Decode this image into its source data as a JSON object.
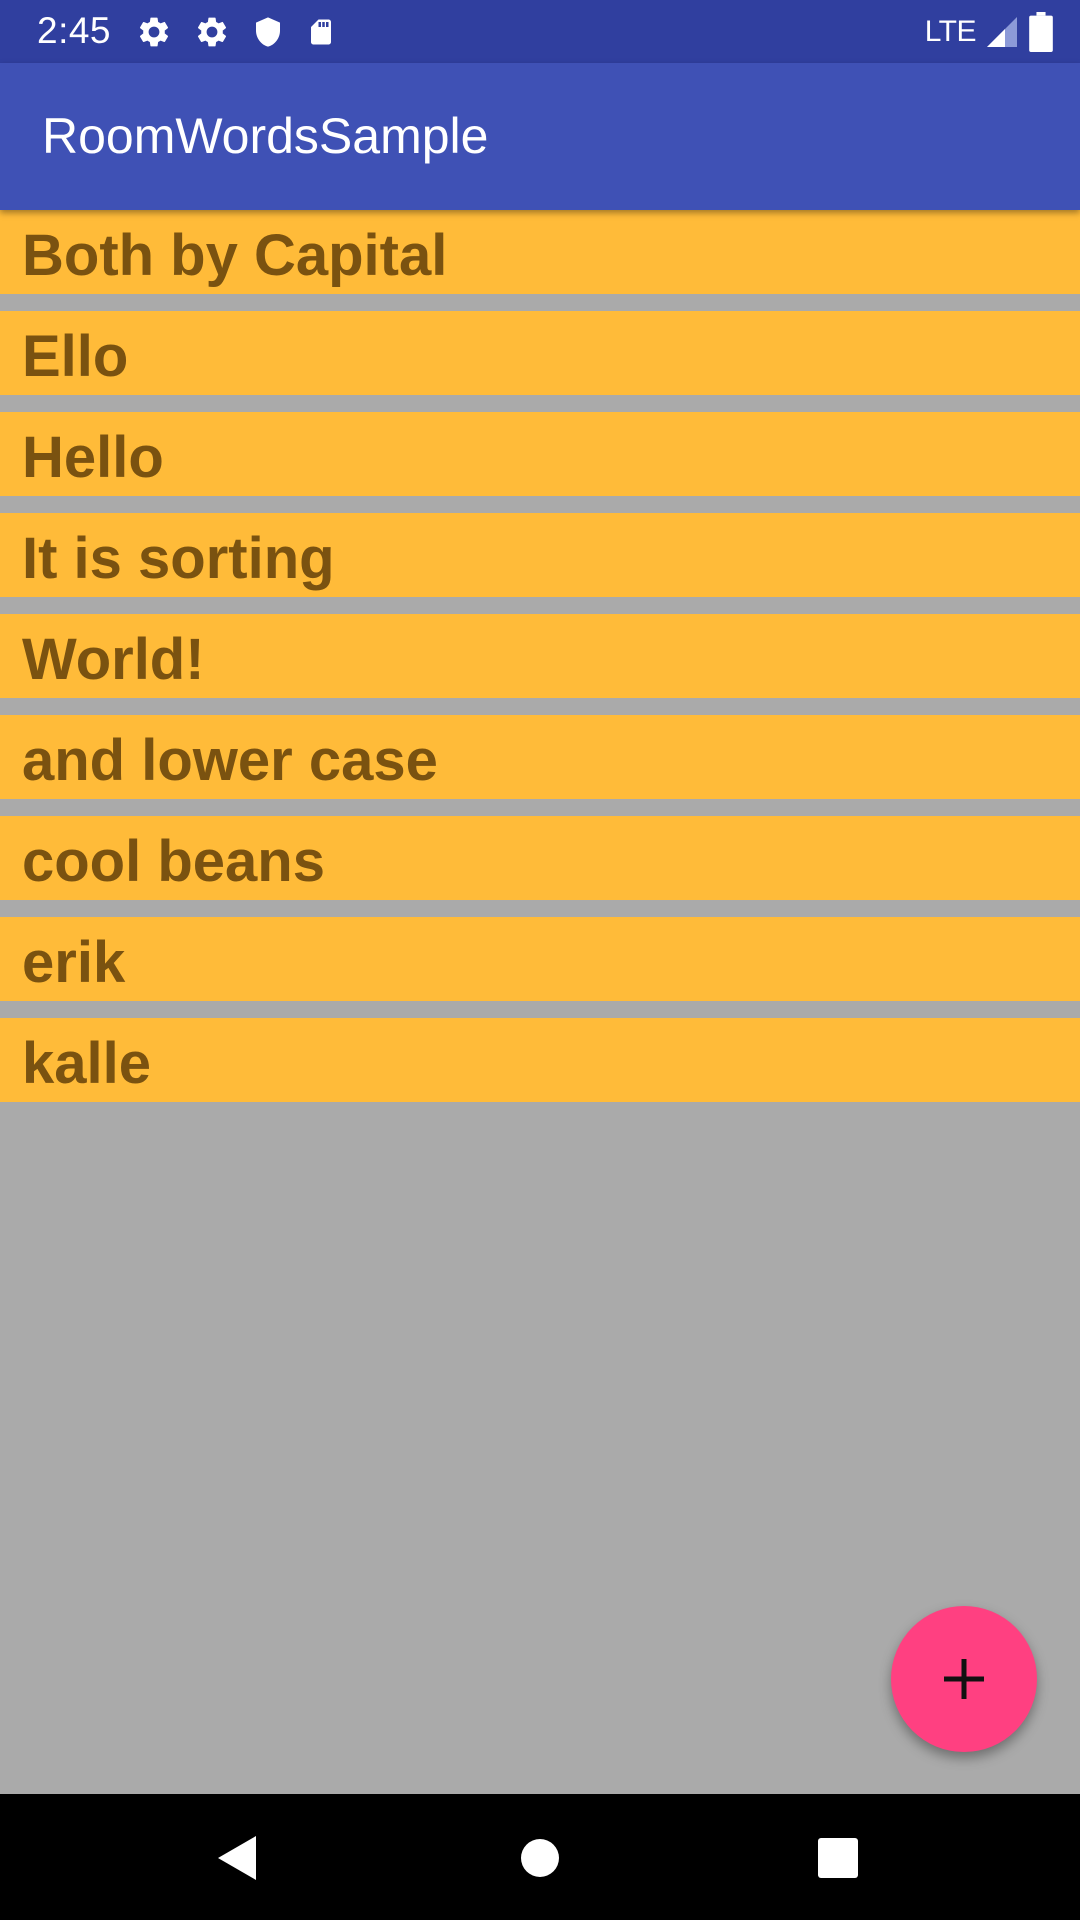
{
  "status_bar": {
    "time": "2:45",
    "network": "LTE",
    "left_icons": [
      "settings-icon",
      "settings-icon",
      "shield-icon",
      "sd-card-icon"
    ],
    "right_icons": [
      "signal-icon",
      "battery-icon"
    ]
  },
  "app_bar": {
    "title": "RoomWordsSample"
  },
  "words": [
    "Both by Capital",
    "Ello",
    "Hello",
    "It is sorting",
    "World!",
    "and lower case",
    "cool beans",
    "erik",
    "kalle"
  ],
  "fab": {
    "icon": "plus-icon",
    "color": "#ff4081"
  },
  "nav_bar": {
    "buttons": [
      "back-icon",
      "home-icon",
      "recents-icon"
    ]
  },
  "colors": {
    "status_bar": "#303f9f",
    "app_bar": "#3f51b5",
    "list_item": "#ffbb39",
    "list_text": "#7a5210",
    "background": "#aaaaaa"
  }
}
